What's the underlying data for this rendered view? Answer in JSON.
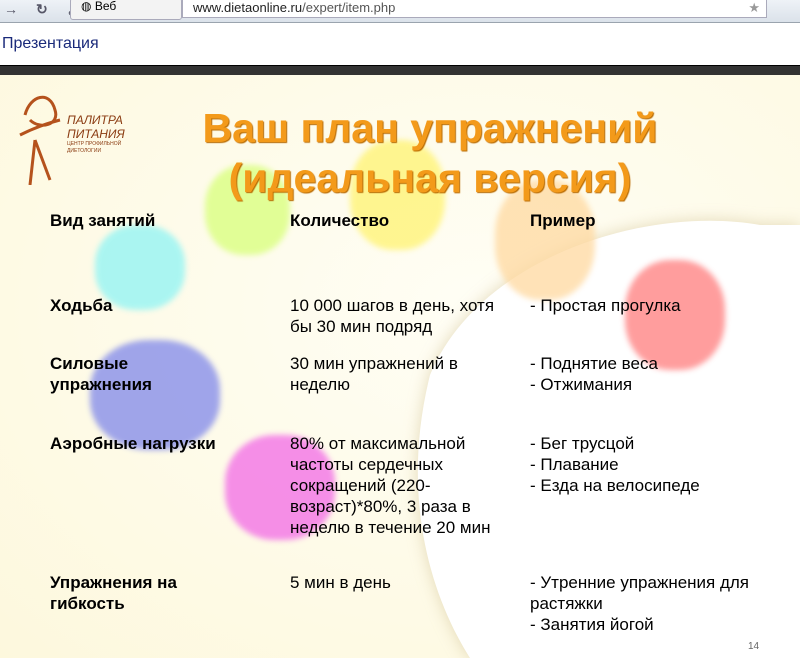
{
  "browser": {
    "tab_label": "Веб",
    "url_domain": "www.dietaonline.ru",
    "url_path": "/expert/item.php"
  },
  "page_title": "Презентация",
  "slide": {
    "logo": {
      "line1": "ПАЛИТРА",
      "line2": "ПИТАНИЯ",
      "sub": "ЦЕНТР ПРОФИЛЬНОЙ ДИЕТОЛОГИИ"
    },
    "title_line1": "Ваш план упражнений",
    "title_line2": "(идеальная версия)",
    "headers": [
      "Вид занятий",
      "Количество",
      "Пример"
    ],
    "rows": [
      {
        "type": "Ходьба",
        "amount": "10 000 шагов в день, хотя бы 30 мин подряд",
        "example": [
          "- Простая прогулка"
        ]
      },
      {
        "type": "Силовые упражнения",
        "amount": "30 мин упражнений в неделю",
        "example": [
          "- Поднятие веса",
          "- Отжимания"
        ]
      },
      {
        "type": "Аэробные нагрузки",
        "amount": "80% от максимальной частоты сердечных сокращений  (220-возраст)*80%, 3 раза в неделю в течение 20 мин",
        "example": [
          "- Бег трусцой",
          "- Плавание",
          "- Езда на велосипеде"
        ]
      },
      {
        "type": "Упражнения на гибкость",
        "amount": "5 мин в день",
        "example": [
          "- Утренние упражнения для растяжки",
          "- Занятия йогой"
        ]
      }
    ],
    "page_number": "14"
  }
}
